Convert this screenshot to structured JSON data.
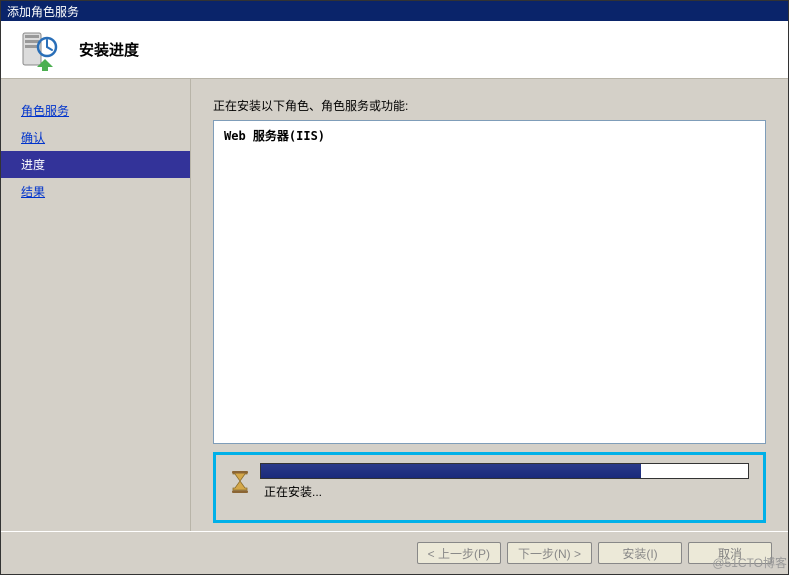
{
  "titlebar": {
    "title": "添加角色服务"
  },
  "header": {
    "title": "安装进度"
  },
  "sidebar": {
    "items": [
      {
        "label": "角色服务",
        "active": false
      },
      {
        "label": "确认",
        "active": false
      },
      {
        "label": "进度",
        "active": true
      },
      {
        "label": "结果",
        "active": false
      }
    ]
  },
  "content": {
    "install_label": "正在安装以下角色、角色服务或功能:",
    "role_item": "Web 服务器(IIS)",
    "progress_text": "正在安装..."
  },
  "footer": {
    "prev": "< 上一步(P)",
    "next": "下一步(N) >",
    "install": "安装(I)",
    "cancel": "取消"
  },
  "watermark": "@51CTO博客",
  "chart_data": {
    "type": "bar",
    "title": "安装进度",
    "categories": [
      "progress"
    ],
    "values": [
      78
    ],
    "ylim": [
      0,
      100
    ]
  }
}
